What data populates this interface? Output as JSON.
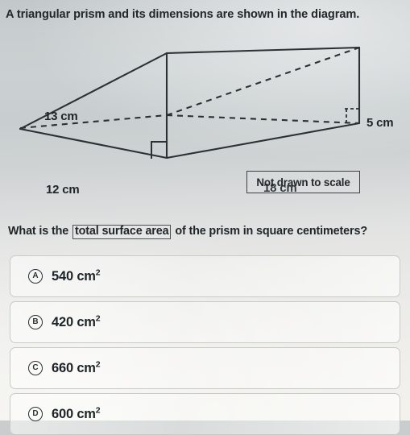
{
  "prompt": "A triangular prism and its dimensions are shown in the diagram.",
  "diagram": {
    "labels": {
      "slant": "13 cm",
      "base": "12 cm",
      "length": "18 cm",
      "height": "5 cm"
    },
    "note_box": "Not drawn to scale",
    "line_color": "#2b3134",
    "right_angle_marks": 2
  },
  "question": {
    "before": "What is the",
    "highlight": "total surface area",
    "after": "of the prism in square centimeters?"
  },
  "choices": [
    {
      "letter": "A",
      "value": "540 cm",
      "exponent": "2"
    },
    {
      "letter": "B",
      "value": "420 cm",
      "exponent": "2"
    },
    {
      "letter": "C",
      "value": "660 cm",
      "exponent": "2"
    },
    {
      "letter": "D",
      "value": "600 cm",
      "exponent": "2"
    }
  ]
}
